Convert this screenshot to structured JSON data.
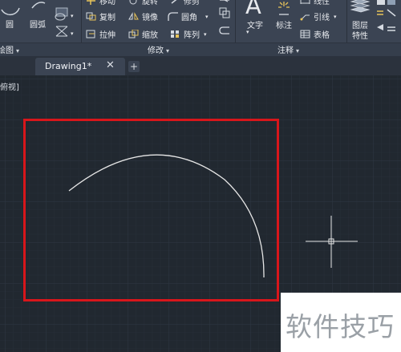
{
  "ribbon": {
    "draw_panel": {
      "title": "绘图",
      "circle_label": "圆",
      "arc_label": "圆弧"
    },
    "modify_panel": {
      "title": "修改",
      "move_label": "移动",
      "rotate_label": "旋转",
      "trim_label": "修剪",
      "copy_label": "复制",
      "mirror_label": "镜像",
      "fillet_label": "圆角",
      "stretch_label": "拉伸",
      "scale_label": "缩放",
      "array_label": "阵列"
    },
    "annotation_panel": {
      "title": "注释",
      "text_label": "文字",
      "dimension_label": "标注",
      "linear_label": "线性",
      "leader_label": "引线",
      "table_label": "表格"
    },
    "layers_panel": {
      "properties_line1": "图层",
      "properties_line2": "特性"
    }
  },
  "tabs": [
    {
      "label": "Drawing1*",
      "close": "✕"
    }
  ],
  "new_tab_label": "+",
  "viewport_label": "俯视]",
  "watermark": "软件技巧",
  "colors": {
    "ribbon": "#3b4453",
    "canvas": "#212830",
    "highlight": "#d8161b",
    "arc": "#e6e6e6"
  }
}
